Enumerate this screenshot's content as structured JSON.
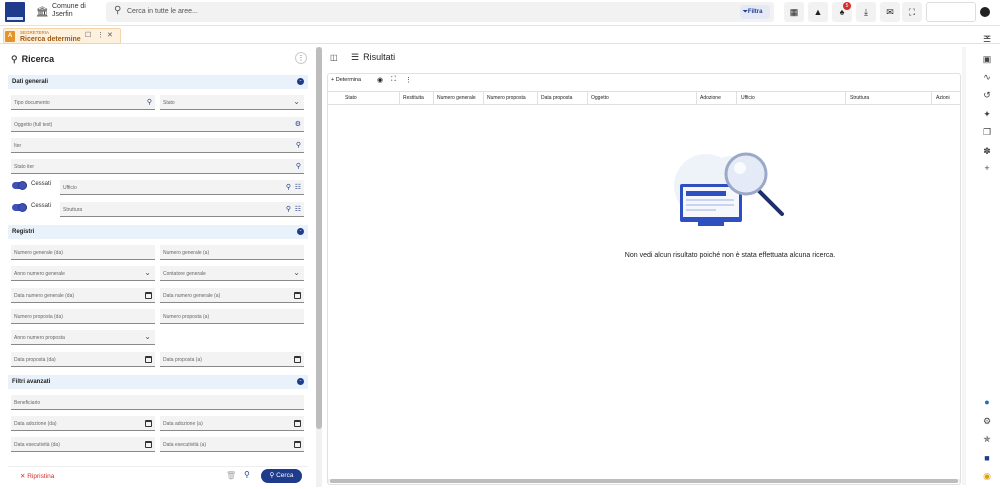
{
  "topbar": {
    "org_line1": "Comune di",
    "org_line2": "Jserfin",
    "search_placeholder": "Cerca in tutte le aree...",
    "filter_label": "Filtra",
    "notifications_count": "5"
  },
  "tab": {
    "category": "SEGRETERIA",
    "title": "Ricerca determine"
  },
  "left": {
    "title": "Ricerca",
    "sections": {
      "general": "Dati generali",
      "registers": "Registri",
      "advanced": "Filtri avanzati"
    },
    "fields": {
      "tipo_documento": "Tipo documento",
      "stato": "Stato",
      "oggetto": "Oggetto (full text)",
      "iter": "Iter",
      "stato_iter": "Stato iter",
      "cessati_ufficio": "Cessati",
      "ufficio": "Ufficio",
      "cessati_struttura": "Cessati",
      "struttura": "Struttura",
      "num_gen_da": "Numero generale (da)",
      "num_gen_a": "Numero generale (a)",
      "anno_num_gen": "Anno numero generale",
      "contatore_gen": "Contatore generale",
      "data_num_gen_da": "Data numero generale (da)",
      "data_num_gen_a": "Data numero generale (a)",
      "num_prop_da": "Numero proposta (da)",
      "num_prop_a": "Numero proposta (a)",
      "anno_num_prop": "Anno numero proposta",
      "data_prop_da": "Data proposta (da)",
      "data_prop_a": "Data proposta (a)",
      "beneficiario": "Beneficiario",
      "data_adoz_da": "Data adozione (da)",
      "data_adoz_a": "Data adozione (a)",
      "data_esec_da": "Data esecutività (da)",
      "data_esec_a": "Data esecutività (a)"
    },
    "reset_label": "Ripristina",
    "search_label": "Cerca"
  },
  "right": {
    "title": "Risultati",
    "toolbar_add_label": "+ Determina",
    "columns": [
      "Stato",
      "Restituita",
      "Numero generale",
      "Numero proposta",
      "Data proposta",
      "Oggetto",
      "Adozione",
      "Ufficio",
      "Struttura",
      "Azioni"
    ],
    "empty_message": "Non vedi alcun risultato poiché non è stata effettuata alcuna ricerca."
  },
  "colors": {
    "primary": "#1f3c8c",
    "section_bg": "#e9f1fb",
    "tab_bg": "#fdf0dd",
    "danger": "#d32f2f"
  }
}
